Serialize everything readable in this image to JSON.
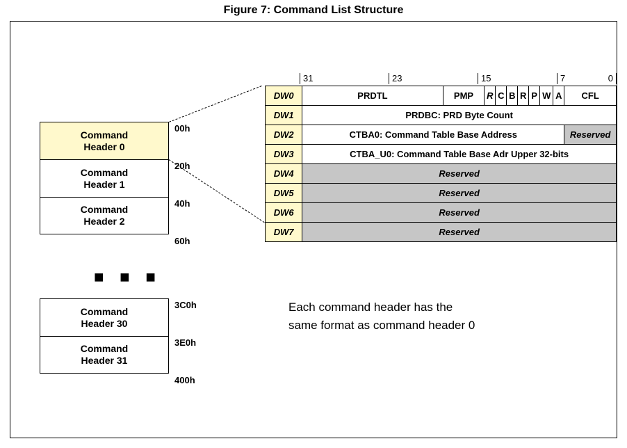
{
  "title": "Figure 7: Command List Structure",
  "headers_top": [
    {
      "line1": "Command",
      "line2": "Header 0",
      "highlight": true
    },
    {
      "line1": "Command",
      "line2": "Header 1",
      "highlight": false
    },
    {
      "line1": "Command",
      "line2": "Header 2",
      "highlight": false
    }
  ],
  "headers_bottom": [
    {
      "line1": "Command",
      "line2": "Header 30"
    },
    {
      "line1": "Command",
      "line2": "Header 31"
    }
  ],
  "offsets_top": [
    "00h",
    "20h",
    "40h",
    "60h"
  ],
  "offsets_bottom": [
    "3C0h",
    "3E0h",
    "400h"
  ],
  "ellipsis": "■ ■ ■",
  "bit_ticks": [
    "31",
    "23",
    "15",
    "7",
    "0"
  ],
  "dw_rows": [
    {
      "label": "DW0"
    },
    {
      "label": "DW1"
    },
    {
      "label": "DW2"
    },
    {
      "label": "DW3"
    },
    {
      "label": "DW4"
    },
    {
      "label": "DW5"
    },
    {
      "label": "DW6"
    },
    {
      "label": "DW7"
    }
  ],
  "dw0": {
    "prdtl": "PRDTL",
    "pmp": "PMP",
    "R": "R",
    "C": "C",
    "B": "B",
    "R2": "R",
    "P": "P",
    "W": "W",
    "A": "A",
    "cfl": "CFL"
  },
  "dw1": {
    "text": "PRDBC: PRD Byte Count"
  },
  "dw2": {
    "main": "CTBA0: Command Table Base Address",
    "res": "Reserved"
  },
  "dw3": {
    "text": "CTBA_U0: Command Table Base Adr Upper 32-bits"
  },
  "reserved_text": "Reserved",
  "note_line1": "Each command header has the",
  "note_line2": "same format as command header 0"
}
